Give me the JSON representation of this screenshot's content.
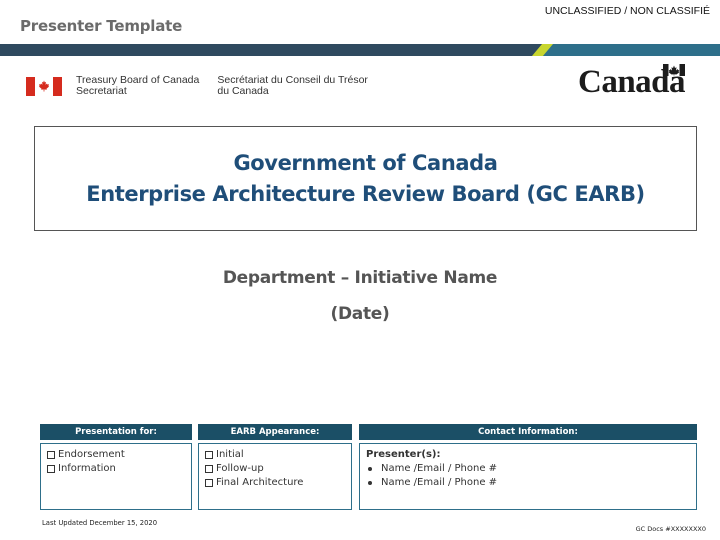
{
  "header": {
    "classification": "UNCLASSIFIED / NON CLASSIFIÉ",
    "slide_label": "Presenter Template"
  },
  "department": {
    "name_en_line1": "Treasury Board of Canada",
    "name_en_line2": "Secretariat",
    "name_fr_line1": "Secrétariat du Conseil du Trésor",
    "name_fr_line2": "du Canada"
  },
  "wordmark": {
    "text": "Canada"
  },
  "title": {
    "line1": "Government of Canada",
    "line2": "Enterprise Architecture Review Board (GC EARB)"
  },
  "subtitle": {
    "line1": "Department – Initiative Name",
    "line2": "(Date)"
  },
  "panels": {
    "presentation_for": {
      "heading": "Presentation for:",
      "options": [
        "Endorsement",
        "Information"
      ]
    },
    "earb_appearance": {
      "heading": "EARB Appearance:",
      "options": [
        "Initial",
        "Follow-up",
        "Final Architecture"
      ]
    },
    "contact": {
      "heading": "Contact Information:",
      "presenters_label": "Presenter(s):",
      "entries": [
        "Name /Email / Phone #",
        "Name /Email / Phone #"
      ]
    }
  },
  "footer": {
    "last_updated": "Last Updated  December 15, 2020",
    "doc_number": "GC Docs #XXXXXXX0"
  },
  "colors": {
    "title_blue": "#1f4e79",
    "header_band_navy": "#2f4a5f",
    "header_band_teal": "#2e6f8a",
    "accent_lime": "#c8d62f",
    "panel_header": "#1b4f66",
    "flag_red": "#d52b1e"
  }
}
